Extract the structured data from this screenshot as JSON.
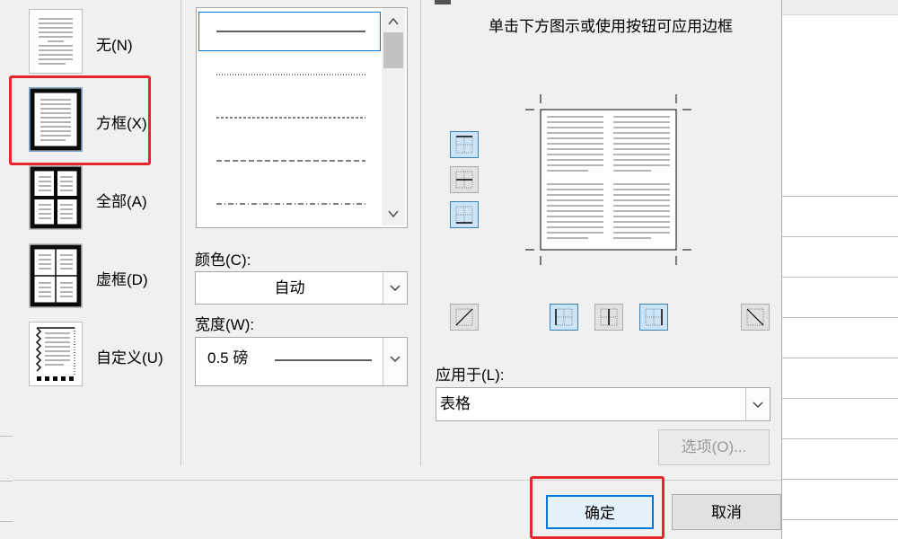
{
  "settings": {
    "items": [
      {
        "label": "无(N)"
      },
      {
        "label": "方框(X)"
      },
      {
        "label": "全部(A)"
      },
      {
        "label": "虚框(D)"
      },
      {
        "label": "自定义(U)"
      }
    ],
    "selected": "方框(X)"
  },
  "style": {
    "line_styles": [
      "solid-thin",
      "dotted",
      "dashed-small",
      "dashed",
      "dash-dot"
    ]
  },
  "color": {
    "label": "颜色(C):",
    "value": "自动"
  },
  "width": {
    "label": "宽度(W):",
    "value": "0.5 磅"
  },
  "preview": {
    "instruction": "单击下方图示或使用按钮可应用边框"
  },
  "apply_to": {
    "label": "应用于(L):",
    "value": "表格"
  },
  "buttons": {
    "options": "选项(O)...",
    "ok": "确定",
    "cancel": "取消"
  },
  "highlight_color": "#e8252b"
}
